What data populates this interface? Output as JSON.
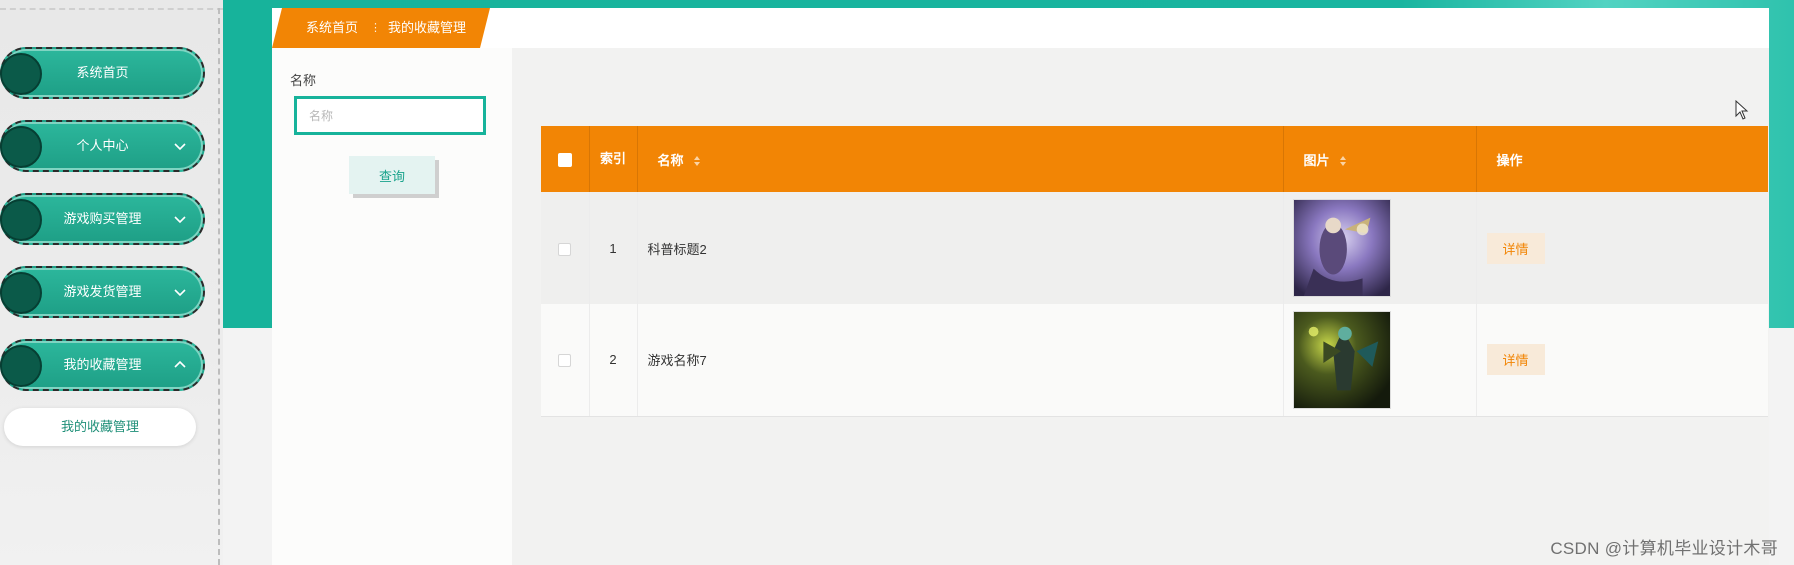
{
  "sidebar": {
    "items": [
      {
        "label": "系统首页",
        "has_chevron": false
      },
      {
        "label": "个人中心",
        "has_chevron": true,
        "chevron": "down"
      },
      {
        "label": "游戏购买管理",
        "has_chevron": true,
        "chevron": "down"
      },
      {
        "label": "游戏发货管理",
        "has_chevron": true,
        "chevron": "down"
      },
      {
        "label": "我的收藏管理",
        "has_chevron": true,
        "chevron": "up"
      }
    ],
    "submenu": [
      {
        "label": "我的收藏管理"
      }
    ]
  },
  "breadcrumb": {
    "home": "系统首页",
    "separator": "⋮",
    "current": "我的收藏管理"
  },
  "search": {
    "label": "名称",
    "placeholder": "名称",
    "value": "",
    "button": "查询"
  },
  "table": {
    "columns": {
      "index": "索引",
      "name": "名称",
      "image": "图片",
      "action": "操作"
    },
    "rows": [
      {
        "index": "1",
        "name": "科普标题2",
        "image": "game-artwork-purple-warrior",
        "action": "详情"
      },
      {
        "index": "2",
        "name": "游戏名称7",
        "image": "game-artwork-green-demon",
        "action": "详情"
      }
    ]
  },
  "watermark": "CSDN @计算机毕业设计木哥",
  "colors": {
    "teal": "#17b39b",
    "orange": "#f28505",
    "dark_green": "#0b5a49"
  }
}
